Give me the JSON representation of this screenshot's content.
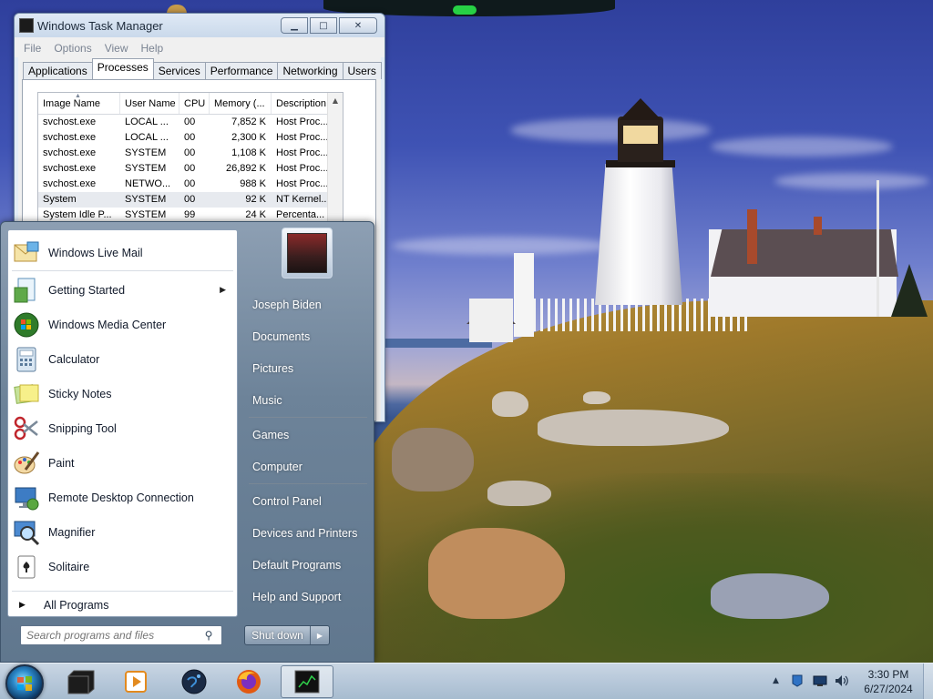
{
  "task_manager": {
    "title": "Windows Task Manager",
    "menu": [
      "File",
      "Options",
      "View",
      "Help"
    ],
    "tabs": [
      "Applications",
      "Processes",
      "Services",
      "Performance",
      "Networking",
      "Users"
    ],
    "active_tab": "Processes",
    "columns": [
      "Image Name",
      "User Name",
      "CPU",
      "Memory (...",
      "Description"
    ],
    "rows": [
      {
        "name": "svchost.exe",
        "user": "LOCAL ...",
        "cpu": "00",
        "mem": "7,852 K",
        "desc": "Host Proc..."
      },
      {
        "name": "svchost.exe",
        "user": "LOCAL ...",
        "cpu": "00",
        "mem": "2,300 K",
        "desc": "Host Proc..."
      },
      {
        "name": "svchost.exe",
        "user": "SYSTEM",
        "cpu": "00",
        "mem": "1,108 K",
        "desc": "Host Proc..."
      },
      {
        "name": "svchost.exe",
        "user": "SYSTEM",
        "cpu": "00",
        "mem": "26,892 K",
        "desc": "Host Proc..."
      },
      {
        "name": "svchost.exe",
        "user": "NETWO...",
        "cpu": "00",
        "mem": "988 K",
        "desc": "Host Proc..."
      },
      {
        "name": "System",
        "user": "SYSTEM",
        "cpu": "00",
        "mem": "92 K",
        "desc": "NT Kernel..."
      },
      {
        "name": "System Idle P...",
        "user": "SYSTEM",
        "cpu": "99",
        "mem": "24 K",
        "desc": "Percenta..."
      }
    ]
  },
  "start_menu": {
    "programs": [
      {
        "label": "Windows Live Mail",
        "icon": "mail-icon"
      },
      {
        "label": "Getting Started",
        "icon": "getting-started-icon",
        "submenu": true
      },
      {
        "label": "Windows Media Center",
        "icon": "media-center-icon"
      },
      {
        "label": "Calculator",
        "icon": "calculator-icon"
      },
      {
        "label": "Sticky Notes",
        "icon": "sticky-notes-icon"
      },
      {
        "label": "Snipping Tool",
        "icon": "scissors-icon"
      },
      {
        "label": "Paint",
        "icon": "paint-icon"
      },
      {
        "label": "Remote Desktop Connection",
        "icon": "remote-desktop-icon"
      },
      {
        "label": "Magnifier",
        "icon": "magnifier-icon"
      },
      {
        "label": "Solitaire",
        "icon": "solitaire-icon"
      }
    ],
    "all_programs": "All Programs",
    "search_placeholder": "Search programs and files",
    "user_name": "Joseph Biden",
    "right_links": [
      "Documents",
      "Pictures",
      "Music",
      "Games",
      "Computer",
      "Control Panel",
      "Devices and Printers",
      "Default Programs",
      "Help and Support"
    ],
    "shutdown_label": "Shut down"
  },
  "taskbar": {
    "pinned": [
      "file-explorer-icon",
      "media-player-icon",
      "globe-icon",
      "firefox-icon",
      "task-manager-icon"
    ],
    "clock_time": "3:30 PM",
    "clock_date": "6/27/2024"
  }
}
